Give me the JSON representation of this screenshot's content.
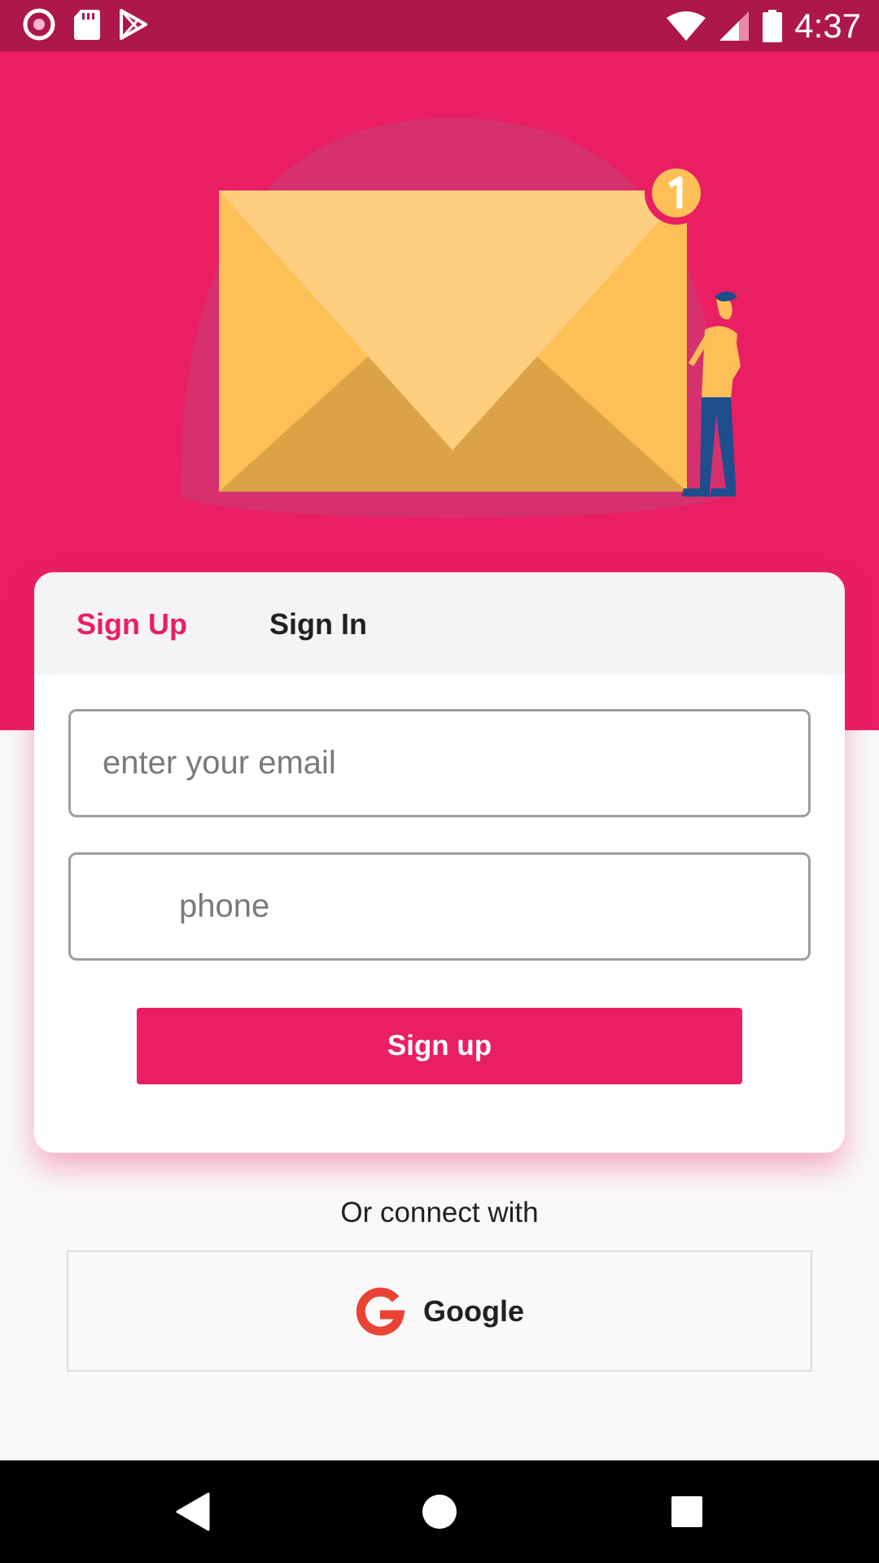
{
  "status_bar": {
    "time": "4:37",
    "left_icons": [
      "record-icon",
      "sd-card-icon",
      "play-store-icon"
    ],
    "right_icons": [
      "wifi-icon",
      "cell-signal-icon",
      "battery-icon"
    ]
  },
  "hero": {
    "badge_count": "1",
    "illustration": "envelope-with-person"
  },
  "tabs": [
    {
      "label": "Sign Up",
      "active": true
    },
    {
      "label": "Sign In",
      "active": false
    }
  ],
  "form": {
    "email_placeholder": "enter your email",
    "email_value": "",
    "phone_placeholder": "phone",
    "phone_value": "",
    "submit_label": "Sign up"
  },
  "social": {
    "connect_label": "Or connect with",
    "google_label": "Google"
  },
  "colors": {
    "accent": "#e91e63",
    "status_bar": "#ad1749",
    "envelope": "#ffbf57",
    "envelope_flap": "#ffcf80",
    "envelope_bottom": "#dba346"
  }
}
